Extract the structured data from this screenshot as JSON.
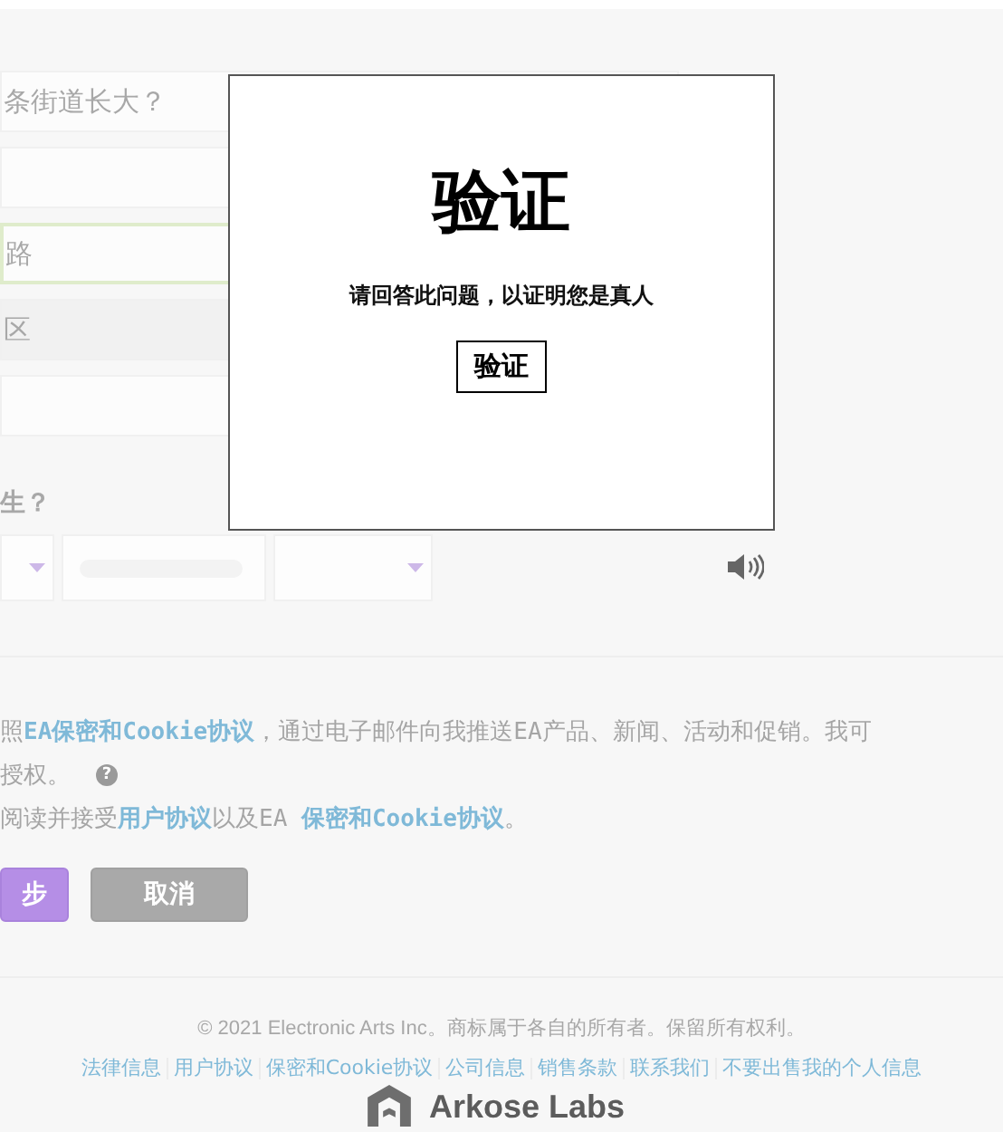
{
  "form": {
    "fields": [
      {
        "kind": "input",
        "placeholder": "条街道长大？",
        "focused": false
      },
      {
        "kind": "input",
        "focused": false
      },
      {
        "kind": "input",
        "placeholder": "路",
        "focused": true
      },
      {
        "kind": "select",
        "placeholder": "区",
        "focused": false
      },
      {
        "kind": "input",
        "focused": false
      }
    ],
    "birth_label": "生？",
    "date_fields": [
      {
        "kind": "select"
      },
      {
        "kind": "input"
      },
      {
        "kind": "select"
      }
    ]
  },
  "consent": [
    {
      "parts": [
        {
          "text": "照",
          "link": false
        },
        {
          "text": "EA保密和Cookie协议",
          "link": true
        },
        {
          "text": "，通过电子邮件向我推送EA产品、新闻、活动和促销。我可",
          "link": false
        }
      ]
    },
    {
      "parts": [
        {
          "text": "授权。",
          "link": false
        }
      ],
      "help": "?"
    },
    {
      "parts": [
        {
          "text": "阅读并接受",
          "link": false
        },
        {
          "text": "用户协议",
          "link": true
        },
        {
          "text": "以及EA ",
          "link": false
        },
        {
          "text": "保密和Cookie协议",
          "link": true
        },
        {
          "text": "。",
          "link": false
        }
      ]
    }
  ],
  "buttons": [
    {
      "label": "步",
      "kind": "primary"
    },
    {
      "label": "取消",
      "kind": "secondary"
    }
  ],
  "footer": {
    "copyright": "© 2021 Electronic Arts Inc。商标属于各自的所有者。保留所有权利。",
    "links": [
      "法律信息",
      "用户协议",
      "保密和Cookie协议",
      "公司信息",
      "销售条款",
      "联系我们",
      "不要出售我的个人信息"
    ]
  },
  "captcha": {
    "title": "验证",
    "prompt": "请回答此问题，以证明您是真人",
    "button": "验证",
    "brand": "Arkose Labs"
  }
}
